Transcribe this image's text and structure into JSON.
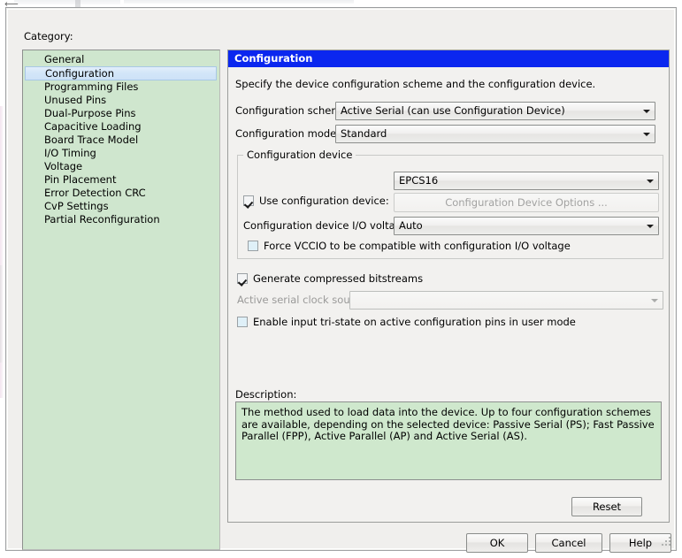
{
  "window": {
    "category_label": "Category:"
  },
  "sidebar": {
    "items": [
      {
        "label": "General",
        "selected": false
      },
      {
        "label": "Configuration",
        "selected": true
      },
      {
        "label": "Programming Files",
        "selected": false
      },
      {
        "label": "Unused Pins",
        "selected": false
      },
      {
        "label": "Dual-Purpose Pins",
        "selected": false
      },
      {
        "label": "Capacitive Loading",
        "selected": false
      },
      {
        "label": "Board Trace Model",
        "selected": false
      },
      {
        "label": "I/O Timing",
        "selected": false
      },
      {
        "label": "Voltage",
        "selected": false
      },
      {
        "label": "Pin Placement",
        "selected": false
      },
      {
        "label": "Error Detection CRC",
        "selected": false
      },
      {
        "label": "CvP Settings",
        "selected": false
      },
      {
        "label": "Partial Reconfiguration",
        "selected": false
      }
    ]
  },
  "panel": {
    "title": "Configuration",
    "subtitle": "Specify the device configuration scheme and the configuration device.",
    "scheme_label": "Configuration scheme:",
    "scheme_value": "Active Serial (can use Configuration Device)",
    "mode_label": "Configuration mode:",
    "mode_value": "Standard",
    "group_legend": "Configuration device",
    "use_device_label": "Use configuration device:",
    "use_device_checked": true,
    "device_value": "EPCS16",
    "device_options_button": "Configuration Device Options ...",
    "io_voltage_label": "Configuration device I/O voltage:",
    "io_voltage_value": "Auto",
    "force_vccio_label": "Force VCCIO to be compatible with configuration I/O voltage",
    "force_vccio_checked": false,
    "compressed_label": "Generate compressed bitstreams",
    "compressed_checked": true,
    "clock_source_label": "Active serial clock source:",
    "clock_source_value": "",
    "tristate_label": "Enable input tri-state on active configuration pins in user mode",
    "tristate_checked": false,
    "description_label": "Description:",
    "description_text": "The method used to load data into the device. Up to four configuration schemes are available, depending on the selected device: Passive Serial (PS); Fast Passive Parallel (FPP), Active Parallel (AP) and Active Serial (AS).",
    "reset_button": "Reset"
  },
  "buttons": {
    "ok": "OK",
    "cancel": "Cancel",
    "help": "Help"
  },
  "colors": {
    "title_bar": "#0b27ef",
    "list_bg": "#cfe6ce",
    "desc_bg": "#cfe8cd",
    "selection": "#d3e6f8"
  }
}
